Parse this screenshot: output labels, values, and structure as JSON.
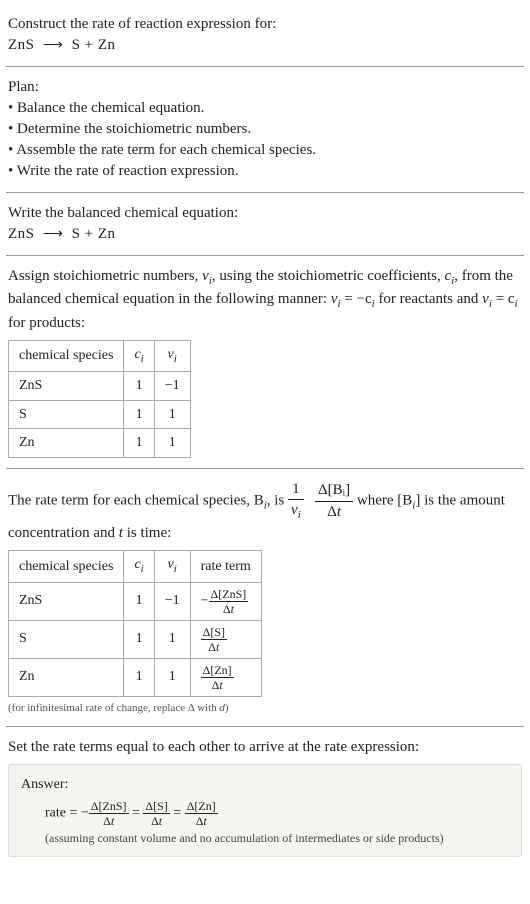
{
  "header": {
    "prompt": "Construct the rate of reaction expression for:",
    "equation_lhs": "ZnS",
    "equation_rhs": "S + Zn"
  },
  "plan": {
    "title": "Plan:",
    "items": [
      "Balance the chemical equation.",
      "Determine the stoichiometric numbers.",
      "Assemble the rate term for each chemical species.",
      "Write the rate of reaction expression."
    ]
  },
  "balanced": {
    "intro": "Write the balanced chemical equation:",
    "equation_lhs": "ZnS",
    "equation_rhs": "S + Zn"
  },
  "stoich": {
    "intro_pre": "Assign stoichiometric numbers, ",
    "nu_i": "ν",
    "nu_sub": "i",
    "intro_mid": ", using the stoichiometric coefficients, ",
    "c_i": "c",
    "c_sub": "i",
    "intro_post1": ", from the balanced chemical equation in the following manner: ",
    "rule_reactants_pre": "ν",
    "rule_reactants": " = −c",
    "rule_reactants_post": " for reactants and ",
    "rule_products": " = c",
    "rule_products_post": " for products:",
    "table": {
      "head": [
        "chemical species",
        "cᵢ",
        "νᵢ"
      ],
      "rows": [
        {
          "species": "ZnS",
          "c": "1",
          "nu": "−1"
        },
        {
          "species": "S",
          "c": "1",
          "nu": "1"
        },
        {
          "species": "Zn",
          "c": "1",
          "nu": "1"
        }
      ]
    }
  },
  "rateterm": {
    "intro_pre": "The rate term for each chemical species, B",
    "intro_sub": "i",
    "intro_mid": ", is ",
    "frac1_num": "1",
    "frac1_den_sym": "ν",
    "frac1_den_sub": "i",
    "frac2_num": "Δ[Bᵢ]",
    "frac2_den": "Δt",
    "intro_post_pre": " where [B",
    "intro_post_mid": "] is the amount concentration and ",
    "t_label": "t",
    "intro_post_end": " is time:",
    "table": {
      "head": [
        "chemical species",
        "cᵢ",
        "νᵢ",
        "rate term"
      ],
      "rows": [
        {
          "species": "ZnS",
          "c": "1",
          "nu": "−1",
          "rt_sign": "−",
          "rt_num": "Δ[ZnS]",
          "rt_den": "Δt"
        },
        {
          "species": "S",
          "c": "1",
          "nu": "1",
          "rt_sign": "",
          "rt_num": "Δ[S]",
          "rt_den": "Δt"
        },
        {
          "species": "Zn",
          "c": "1",
          "nu": "1",
          "rt_sign": "",
          "rt_num": "Δ[Zn]",
          "rt_den": "Δt"
        }
      ]
    },
    "note": "(for infinitesimal rate of change, replace Δ with d)"
  },
  "setequal": {
    "text": "Set the rate terms equal to each other to arrive at the rate expression:"
  },
  "answer": {
    "label": "Answer:",
    "rate_prefix": "rate = −",
    "term1_num": "Δ[ZnS]",
    "term1_den": "Δt",
    "eq": " = ",
    "term2_num": "Δ[S]",
    "term2_den": "Δt",
    "term3_num": "Δ[Zn]",
    "term3_den": "Δt",
    "assumption": "(assuming constant volume and no accumulation of intermediates or side products)"
  }
}
